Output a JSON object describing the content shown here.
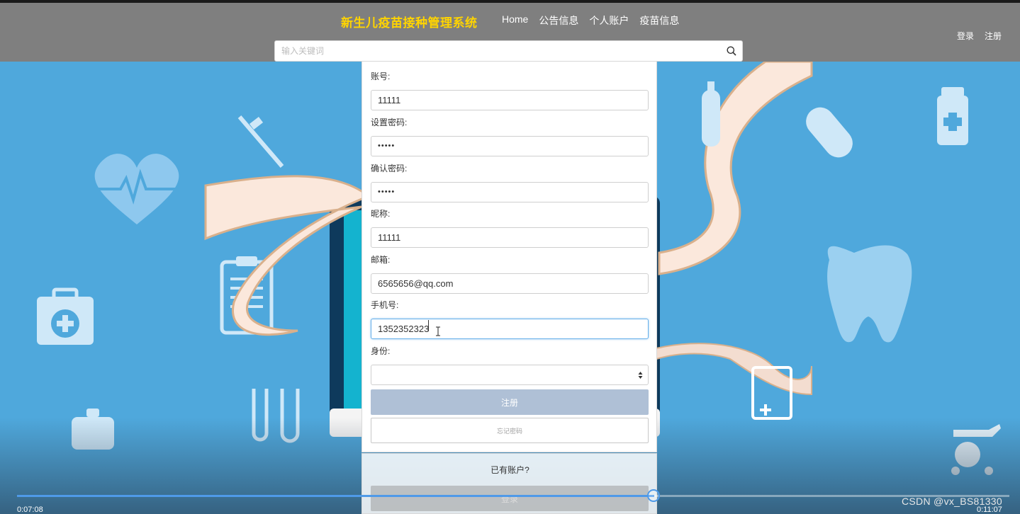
{
  "header": {
    "brand": "新生儿疫苗接种管理系统",
    "nav": [
      "Home",
      "公告信息",
      "个人账户",
      "疫苗信息"
    ],
    "auth": {
      "login": "登录",
      "register": "注册"
    },
    "search_placeholder": "输入关键词"
  },
  "form": {
    "fields": [
      {
        "label": "账号:",
        "value": "11111"
      },
      {
        "label": "设置密码:",
        "value": "•••••"
      },
      {
        "label": "确认密码:",
        "value": "•••••"
      },
      {
        "label": "昵称:",
        "value": "11111"
      },
      {
        "label": "邮箱:",
        "value": "6565656@qq.com"
      },
      {
        "label": "手机号:",
        "value": "1352352323"
      },
      {
        "label": "身份:",
        "value": ""
      }
    ],
    "register_button": "注册",
    "forgot_button": "忘记密码",
    "have_account": "已有账户?",
    "login_button": "登录"
  },
  "video": {
    "current_time": "0:07:08",
    "total_time": "0:11:07",
    "progress": 0.6423
  },
  "watermark": "CSDN @vx_BS81330",
  "colors": {
    "topbar": "#7f7f7f",
    "brand": "#ffd400",
    "background": "#4fa8dc",
    "register_button": "#afc0d6",
    "progress": "#4f9ae8"
  }
}
